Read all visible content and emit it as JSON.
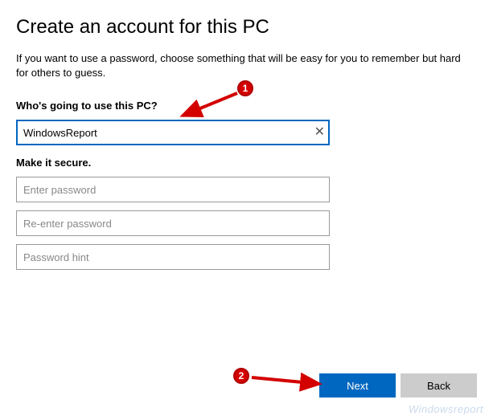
{
  "title": "Create an account for this PC",
  "subtitle": "If you want to use a password, choose something that will be easy for you to remember but hard for others to guess.",
  "section_user": {
    "label": "Who's going to use this PC?",
    "username_value": "WindowsReport"
  },
  "section_secure": {
    "label": "Make it secure.",
    "password_placeholder": "Enter password",
    "reenter_placeholder": "Re-enter password",
    "hint_placeholder": "Password hint"
  },
  "buttons": {
    "next": "Next",
    "back": "Back"
  },
  "annotations": {
    "a1": "1",
    "a2": "2"
  },
  "watermark": "Windowsreport"
}
